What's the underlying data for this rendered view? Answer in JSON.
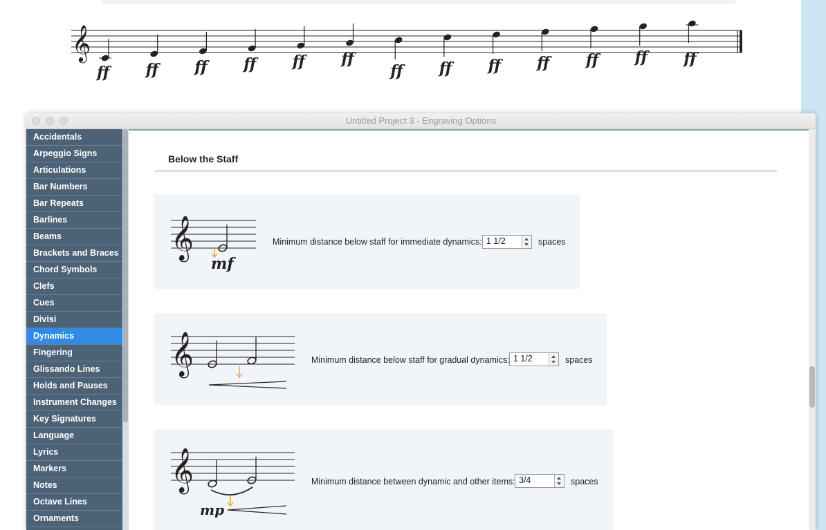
{
  "score": {
    "dynamic_marks": [
      "ff",
      "ff",
      "ff",
      "ff",
      "ff",
      "ff",
      "ff",
      "ff",
      "ff",
      "ff",
      "ff",
      "ff",
      "ff"
    ]
  },
  "window": {
    "title": "Untitled Project 3 - Engraving Options"
  },
  "sidebar": {
    "items": [
      {
        "label": "Accidentals"
      },
      {
        "label": "Arpeggio Signs"
      },
      {
        "label": "Articulations"
      },
      {
        "label": "Bar Numbers"
      },
      {
        "label": "Bar Repeats"
      },
      {
        "label": "Barlines"
      },
      {
        "label": "Beams"
      },
      {
        "label": "Brackets and Braces"
      },
      {
        "label": "Chord Symbols"
      },
      {
        "label": "Clefs"
      },
      {
        "label": "Cues"
      },
      {
        "label": "Divisi"
      },
      {
        "label": "Dynamics",
        "active": true
      },
      {
        "label": "Fingering"
      },
      {
        "label": "Glissando Lines"
      },
      {
        "label": "Holds and Pauses"
      },
      {
        "label": "Instrument Changes"
      },
      {
        "label": "Key Signatures"
      },
      {
        "label": "Language"
      },
      {
        "label": "Lyrics"
      },
      {
        "label": "Markers"
      },
      {
        "label": "Notes"
      },
      {
        "label": "Octave Lines"
      },
      {
        "label": "Ornaments"
      }
    ]
  },
  "section": {
    "title": "Below the Staff"
  },
  "options": [
    {
      "label": "Minimum distance below staff for immediate dynamics:",
      "value": "1 1/2",
      "unit": "spaces",
      "example_dynamic": "mf"
    },
    {
      "label": "Minimum distance below staff for gradual dynamics:",
      "value": "1 1/2",
      "unit": "spaces"
    },
    {
      "label": "Minimum distance between dynamic and other items:",
      "value": "3/4",
      "unit": "spaces",
      "example_dynamic": "mp"
    }
  ],
  "colors": {
    "sidebar_bg": "#4b6277",
    "sidebar_active": "#2f8be5",
    "panel_bg": "#f1f4f8",
    "arrow": "#f0a030",
    "section_rule": "#6f96a3"
  }
}
